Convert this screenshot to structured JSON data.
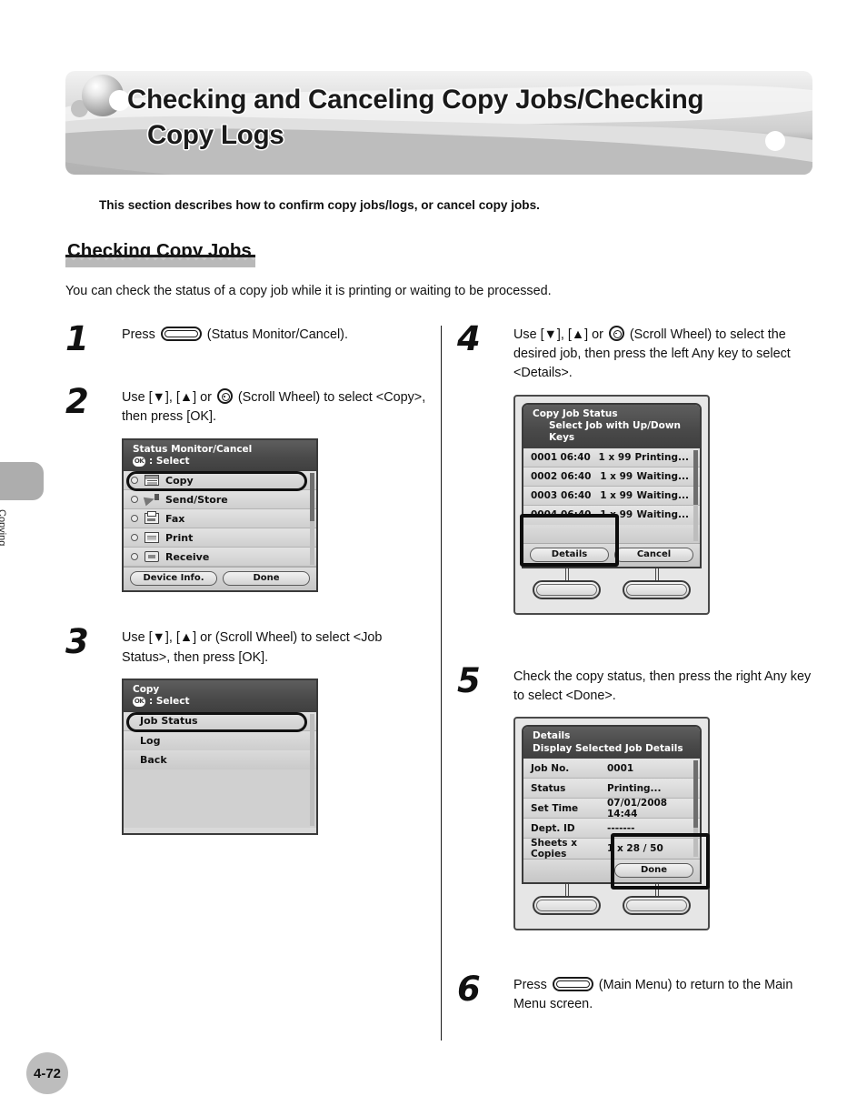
{
  "header": {
    "title_line1": "Checking and Canceling Copy Jobs/Checking",
    "title_line2": "Copy Logs"
  },
  "intro": "This section describes how to confirm copy jobs/logs, or cancel copy jobs.",
  "section": {
    "heading": "Checking Copy Jobs",
    "body": "You can check the status of a copy job while it is printing or waiting to be processed."
  },
  "steps": {
    "s1": {
      "num": "1",
      "text_a": "Press ",
      "text_b": " (Status Monitor/Cancel)."
    },
    "s2": {
      "num": "2",
      "text_a": "Use [▼], [▲] or ",
      "text_b": " (Scroll Wheel) to select <Copy>, then press [OK]."
    },
    "s3": {
      "num": "3",
      "text": "Use [▼], [▲] or (Scroll Wheel) to select <Job Status>, then press [OK]."
    },
    "s4": {
      "num": "4",
      "text_a": "Use [▼], [▲] or ",
      "text_b": " (Scroll Wheel) to select the desired job, then press the left Any key to select <Details>."
    },
    "s5": {
      "num": "5",
      "text": "Check the copy status, then press the right Any key to select <Done>."
    },
    "s6": {
      "num": "6",
      "text_a": "Press ",
      "text_b": " (Main Menu) to return to the Main Menu screen."
    }
  },
  "screen_status_monitor": {
    "title": "Status Monitor/Cancel",
    "ok_badge": "OK",
    "subtitle": ": Select",
    "items": [
      {
        "label": "Copy",
        "icon": "copy-icon",
        "selected": true
      },
      {
        "label": "Send/Store",
        "icon": "send-store-icon",
        "selected": false
      },
      {
        "label": "Fax",
        "icon": "fax-icon",
        "selected": false
      },
      {
        "label": "Print",
        "icon": "print-icon",
        "selected": false
      },
      {
        "label": "Receive",
        "icon": "receive-icon",
        "selected": false
      }
    ],
    "softkeys": [
      "Device Info.",
      "Done"
    ]
  },
  "screen_copy_menu": {
    "title": "Copy",
    "ok_badge": "OK",
    "subtitle": ": Select",
    "items": [
      {
        "label": "Job Status",
        "selected": true
      },
      {
        "label": "Log",
        "selected": false
      },
      {
        "label": "Back",
        "selected": false
      }
    ]
  },
  "screen_job_status": {
    "title": "Copy Job Status",
    "subtitle": "Select Job with Up/Down Keys",
    "columns": [
      "job_no",
      "time",
      "count",
      "status"
    ],
    "rows": [
      {
        "job_no": "0001",
        "time": "06:40",
        "count": "1 x 99",
        "status": "Printing..."
      },
      {
        "job_no": "0002",
        "time": "06:40",
        "count": "1 x 99",
        "status": "Waiting..."
      },
      {
        "job_no": "0003",
        "time": "06:40",
        "count": "1 x 99",
        "status": "Waiting..."
      },
      {
        "job_no": "0004",
        "time": "06:40",
        "count": "1 x 99",
        "status": "Waiting..."
      }
    ],
    "softkey_left": "Details",
    "softkey_right": "Cancel",
    "highlighted_key": "left"
  },
  "screen_details": {
    "title": "Details",
    "subtitle": "Display Selected Job Details",
    "fields": [
      {
        "key": "Job No.",
        "value": "0001"
      },
      {
        "key": "Status",
        "value": "Printing..."
      },
      {
        "key": "Set Time",
        "value": "07/01/2008  14:44"
      },
      {
        "key": "Dept. ID",
        "value": "-------"
      },
      {
        "key": "Sheets x Copies",
        "value": "1 x 28 / 50"
      }
    ],
    "softkey_right": "Done",
    "highlighted_key": "right"
  },
  "sidebar": {
    "tab_label": "Copying"
  },
  "footer": {
    "page_number": "4-72"
  }
}
